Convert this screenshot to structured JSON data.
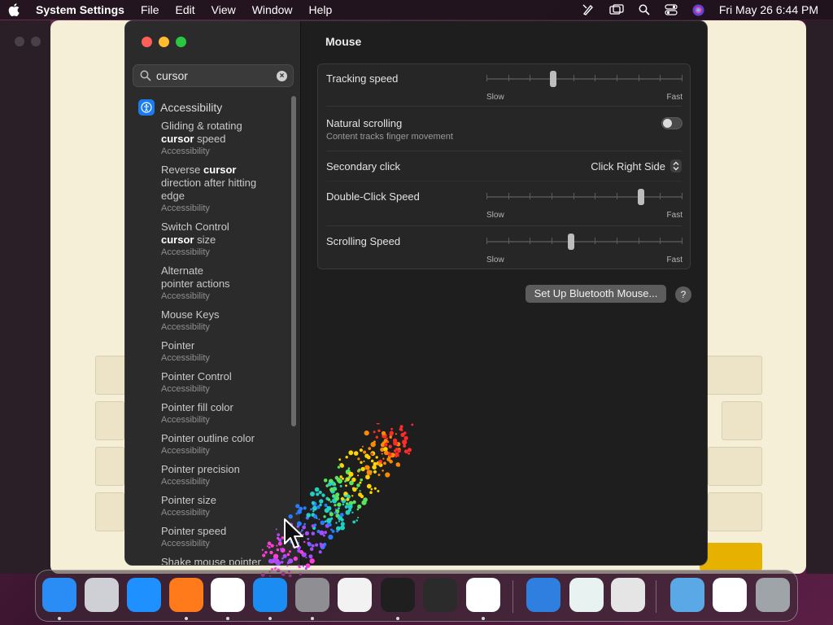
{
  "menubar": {
    "app_name": "System Settings",
    "items": [
      "File",
      "Edit",
      "View",
      "Window",
      "Help"
    ],
    "clock": "Fri May 26  6:44 PM",
    "status_icons": [
      "pen-icon",
      "screen-mirroring-icon",
      "spotlight-icon",
      "control-center-icon",
      "siri-icon"
    ]
  },
  "sidebar": {
    "search": {
      "value": "cursor",
      "placeholder": "Search"
    },
    "category": "Accessibility",
    "results": [
      {
        "parts": [
          [
            "Gliding & rotating",
            ""
          ],
          [
            "cursor",
            " speed"
          ]
        ],
        "sub": "Accessibility"
      },
      {
        "parts": [
          [
            "Reverse ",
            ""
          ],
          [
            "cursor",
            ""
          ],
          [
            "",
            "direction after hitting"
          ],
          [
            "",
            "edge"
          ]
        ],
        "sub": "Accessibility"
      },
      {
        "parts": [
          [
            "Switch Control",
            ""
          ],
          [
            "cursor",
            " size"
          ]
        ],
        "sub": "Accessibility"
      },
      {
        "parts": [
          [
            "Alternate",
            ""
          ],
          [
            "",
            "pointer actions"
          ]
        ],
        "sub": "Accessibility"
      },
      {
        "parts": [
          [
            "Mouse Keys",
            ""
          ]
        ],
        "sub": "Accessibility"
      },
      {
        "parts": [
          [
            "Pointer",
            ""
          ]
        ],
        "sub": "Accessibility"
      },
      {
        "parts": [
          [
            "Pointer Control",
            ""
          ]
        ],
        "sub": "Accessibility"
      },
      {
        "parts": [
          [
            "Pointer fill color",
            ""
          ]
        ],
        "sub": "Accessibility"
      },
      {
        "parts": [
          [
            "Pointer outline color",
            ""
          ]
        ],
        "sub": "Accessibility"
      },
      {
        "parts": [
          [
            "Pointer precision",
            ""
          ]
        ],
        "sub": "Accessibility"
      },
      {
        "parts": [
          [
            "Pointer size",
            ""
          ]
        ],
        "sub": "Accessibility"
      },
      {
        "parts": [
          [
            "Pointer speed",
            ""
          ]
        ],
        "sub": "Accessibility"
      },
      {
        "parts": [
          [
            "Shake mouse pointer",
            ""
          ]
        ],
        "sub": ""
      }
    ]
  },
  "main": {
    "title": "Mouse",
    "tracking": {
      "label": "Tracking speed",
      "slow": "Slow",
      "fast": "Fast",
      "level": 0.34
    },
    "natural": {
      "label": "Natural scrolling",
      "sub": "Content tracks finger movement",
      "on": false
    },
    "secondary": {
      "label": "Secondary click",
      "value": "Click Right Side"
    },
    "doubleclick": {
      "label": "Double-Click Speed",
      "slow": "Slow",
      "fast": "Fast",
      "level": 0.79
    },
    "scrolling": {
      "label": "Scrolling Speed",
      "slow": "Slow",
      "fast": "Fast",
      "level": 0.43
    },
    "bluetooth_button": "Set Up Bluetooth Mouse...",
    "help_button": "?"
  },
  "dock": {
    "apps": [
      {
        "name": "finder-icon",
        "color": "#2a8cf5",
        "running": true
      },
      {
        "name": "launchpad-icon",
        "color": "#cfcfd6",
        "running": false
      },
      {
        "name": "safari-icon",
        "color": "#1e90ff",
        "running": false
      },
      {
        "name": "firefox-icon",
        "color": "#ff7a1a",
        "running": true
      },
      {
        "name": "chrome-icon",
        "color": "#ffffff",
        "running": true
      },
      {
        "name": "app-store-icon",
        "color": "#1b8cf2",
        "running": true
      },
      {
        "name": "system-settings-icon",
        "color": "#8e8e93",
        "running": true
      },
      {
        "name": "textedit-icon",
        "color": "#f2f2f2",
        "running": false
      },
      {
        "name": "terminal-icon",
        "color": "#1f1f1f",
        "running": true
      },
      {
        "name": "garageband-icon",
        "color": "#2b2b2b",
        "running": false
      },
      {
        "name": "vscode-icon",
        "color": "#ffffff",
        "running": true
      },
      {
        "name": "weather-icon",
        "color": "#2f7fe0",
        "running": false
      },
      {
        "name": "screensaver-icon",
        "color": "#e8f2f0",
        "running": false
      },
      {
        "name": "keyboard-viewer-icon",
        "color": "#e5e5e5",
        "running": false
      },
      {
        "name": "folder-downloads-icon",
        "color": "#5aa9e6",
        "running": false
      },
      {
        "name": "document-stack-icon",
        "color": "#ffffff",
        "running": false
      },
      {
        "name": "trash-icon",
        "color": "#9ea4a8",
        "running": false
      }
    ]
  }
}
